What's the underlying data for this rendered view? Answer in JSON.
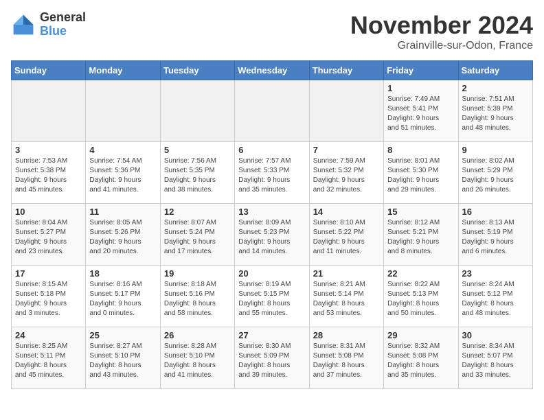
{
  "logo": {
    "general": "General",
    "blue": "Blue"
  },
  "title": "November 2024",
  "location": "Grainville-sur-Odon, France",
  "days_of_week": [
    "Sunday",
    "Monday",
    "Tuesday",
    "Wednesday",
    "Thursday",
    "Friday",
    "Saturday"
  ],
  "weeks": [
    [
      {
        "day": "",
        "info": ""
      },
      {
        "day": "",
        "info": ""
      },
      {
        "day": "",
        "info": ""
      },
      {
        "day": "",
        "info": ""
      },
      {
        "day": "",
        "info": ""
      },
      {
        "day": "1",
        "info": "Sunrise: 7:49 AM\nSunset: 5:41 PM\nDaylight: 9 hours\nand 51 minutes."
      },
      {
        "day": "2",
        "info": "Sunrise: 7:51 AM\nSunset: 5:39 PM\nDaylight: 9 hours\nand 48 minutes."
      }
    ],
    [
      {
        "day": "3",
        "info": "Sunrise: 7:53 AM\nSunset: 5:38 PM\nDaylight: 9 hours\nand 45 minutes."
      },
      {
        "day": "4",
        "info": "Sunrise: 7:54 AM\nSunset: 5:36 PM\nDaylight: 9 hours\nand 41 minutes."
      },
      {
        "day": "5",
        "info": "Sunrise: 7:56 AM\nSunset: 5:35 PM\nDaylight: 9 hours\nand 38 minutes."
      },
      {
        "day": "6",
        "info": "Sunrise: 7:57 AM\nSunset: 5:33 PM\nDaylight: 9 hours\nand 35 minutes."
      },
      {
        "day": "7",
        "info": "Sunrise: 7:59 AM\nSunset: 5:32 PM\nDaylight: 9 hours\nand 32 minutes."
      },
      {
        "day": "8",
        "info": "Sunrise: 8:01 AM\nSunset: 5:30 PM\nDaylight: 9 hours\nand 29 minutes."
      },
      {
        "day": "9",
        "info": "Sunrise: 8:02 AM\nSunset: 5:29 PM\nDaylight: 9 hours\nand 26 minutes."
      }
    ],
    [
      {
        "day": "10",
        "info": "Sunrise: 8:04 AM\nSunset: 5:27 PM\nDaylight: 9 hours\nand 23 minutes."
      },
      {
        "day": "11",
        "info": "Sunrise: 8:05 AM\nSunset: 5:26 PM\nDaylight: 9 hours\nand 20 minutes."
      },
      {
        "day": "12",
        "info": "Sunrise: 8:07 AM\nSunset: 5:24 PM\nDaylight: 9 hours\nand 17 minutes."
      },
      {
        "day": "13",
        "info": "Sunrise: 8:09 AM\nSunset: 5:23 PM\nDaylight: 9 hours\nand 14 minutes."
      },
      {
        "day": "14",
        "info": "Sunrise: 8:10 AM\nSunset: 5:22 PM\nDaylight: 9 hours\nand 11 minutes."
      },
      {
        "day": "15",
        "info": "Sunrise: 8:12 AM\nSunset: 5:21 PM\nDaylight: 9 hours\nand 8 minutes."
      },
      {
        "day": "16",
        "info": "Sunrise: 8:13 AM\nSunset: 5:19 PM\nDaylight: 9 hours\nand 6 minutes."
      }
    ],
    [
      {
        "day": "17",
        "info": "Sunrise: 8:15 AM\nSunset: 5:18 PM\nDaylight: 9 hours\nand 3 minutes."
      },
      {
        "day": "18",
        "info": "Sunrise: 8:16 AM\nSunset: 5:17 PM\nDaylight: 9 hours\nand 0 minutes."
      },
      {
        "day": "19",
        "info": "Sunrise: 8:18 AM\nSunset: 5:16 PM\nDaylight: 8 hours\nand 58 minutes."
      },
      {
        "day": "20",
        "info": "Sunrise: 8:19 AM\nSunset: 5:15 PM\nDaylight: 8 hours\nand 55 minutes."
      },
      {
        "day": "21",
        "info": "Sunrise: 8:21 AM\nSunset: 5:14 PM\nDaylight: 8 hours\nand 53 minutes."
      },
      {
        "day": "22",
        "info": "Sunrise: 8:22 AM\nSunset: 5:13 PM\nDaylight: 8 hours\nand 50 minutes."
      },
      {
        "day": "23",
        "info": "Sunrise: 8:24 AM\nSunset: 5:12 PM\nDaylight: 8 hours\nand 48 minutes."
      }
    ],
    [
      {
        "day": "24",
        "info": "Sunrise: 8:25 AM\nSunset: 5:11 PM\nDaylight: 8 hours\nand 45 minutes."
      },
      {
        "day": "25",
        "info": "Sunrise: 8:27 AM\nSunset: 5:10 PM\nDaylight: 8 hours\nand 43 minutes."
      },
      {
        "day": "26",
        "info": "Sunrise: 8:28 AM\nSunset: 5:10 PM\nDaylight: 8 hours\nand 41 minutes."
      },
      {
        "day": "27",
        "info": "Sunrise: 8:30 AM\nSunset: 5:09 PM\nDaylight: 8 hours\nand 39 minutes."
      },
      {
        "day": "28",
        "info": "Sunrise: 8:31 AM\nSunset: 5:08 PM\nDaylight: 8 hours\nand 37 minutes."
      },
      {
        "day": "29",
        "info": "Sunrise: 8:32 AM\nSunset: 5:08 PM\nDaylight: 8 hours\nand 35 minutes."
      },
      {
        "day": "30",
        "info": "Sunrise: 8:34 AM\nSunset: 5:07 PM\nDaylight: 8 hours\nand 33 minutes."
      }
    ]
  ]
}
